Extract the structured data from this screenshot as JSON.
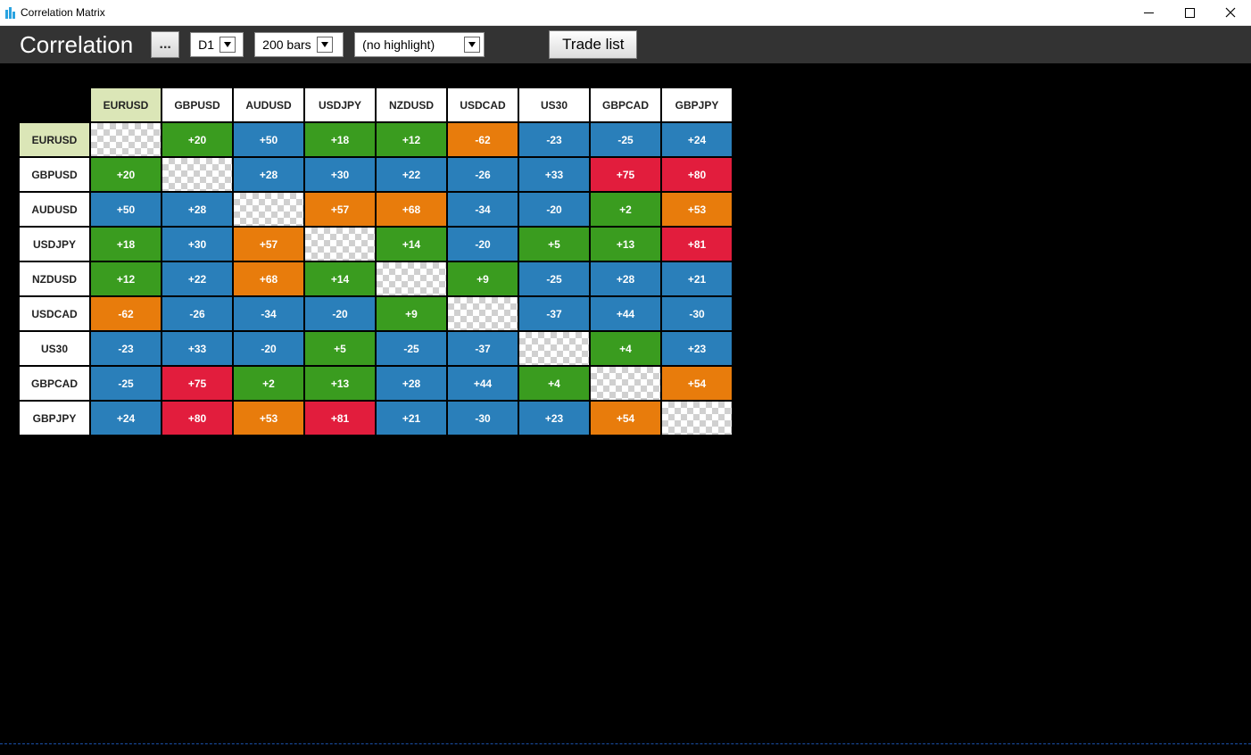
{
  "window": {
    "title": "Correlation Matrix"
  },
  "toolbar": {
    "title": "Correlation",
    "menu_label": "...",
    "timeframe": "D1",
    "bars": "200 bars",
    "highlight": "(no highlight)",
    "trade_list": "Trade list"
  },
  "matrix": {
    "selected": "EURUSD",
    "symbols": [
      "EURUSD",
      "GBPUSD",
      "AUDUSD",
      "USDJPY",
      "NZDUSD",
      "USDCAD",
      "US30",
      "GBPCAD",
      "GBPJPY"
    ],
    "values": [
      [
        null,
        20,
        50,
        18,
        12,
        -62,
        -23,
        -25,
        24
      ],
      [
        20,
        null,
        28,
        30,
        22,
        -26,
        33,
        75,
        80
      ],
      [
        50,
        28,
        null,
        57,
        68,
        -34,
        -20,
        2,
        53
      ],
      [
        18,
        30,
        57,
        null,
        14,
        -20,
        5,
        13,
        81
      ],
      [
        12,
        22,
        68,
        14,
        null,
        9,
        -25,
        28,
        21
      ],
      [
        -62,
        -26,
        -34,
        -20,
        9,
        null,
        -37,
        44,
        -30
      ],
      [
        -23,
        33,
        -20,
        5,
        -25,
        -37,
        null,
        4,
        23
      ],
      [
        -25,
        75,
        2,
        13,
        28,
        44,
        4,
        null,
        54
      ],
      [
        24,
        80,
        53,
        81,
        21,
        -30,
        23,
        54,
        null
      ]
    ],
    "colors": [
      [
        "diag",
        "green",
        "blue",
        "green",
        "green",
        "orange",
        "blue",
        "blue",
        "blue"
      ],
      [
        "green",
        "diag",
        "blue",
        "blue",
        "blue",
        "blue",
        "blue",
        "red",
        "red"
      ],
      [
        "blue",
        "blue",
        "diag",
        "orange",
        "orange",
        "blue",
        "blue",
        "green",
        "orange"
      ],
      [
        "green",
        "blue",
        "orange",
        "diag",
        "green",
        "blue",
        "green",
        "green",
        "red"
      ],
      [
        "green",
        "blue",
        "orange",
        "green",
        "diag",
        "green",
        "blue",
        "blue",
        "blue"
      ],
      [
        "orange",
        "blue",
        "blue",
        "blue",
        "green",
        "diag",
        "blue",
        "blue",
        "blue"
      ],
      [
        "blue",
        "blue",
        "blue",
        "green",
        "blue",
        "blue",
        "diag",
        "green",
        "blue"
      ],
      [
        "blue",
        "red",
        "green",
        "green",
        "blue",
        "blue",
        "green",
        "diag",
        "orange"
      ],
      [
        "blue",
        "red",
        "orange",
        "red",
        "blue",
        "blue",
        "blue",
        "orange",
        "diag"
      ]
    ]
  }
}
